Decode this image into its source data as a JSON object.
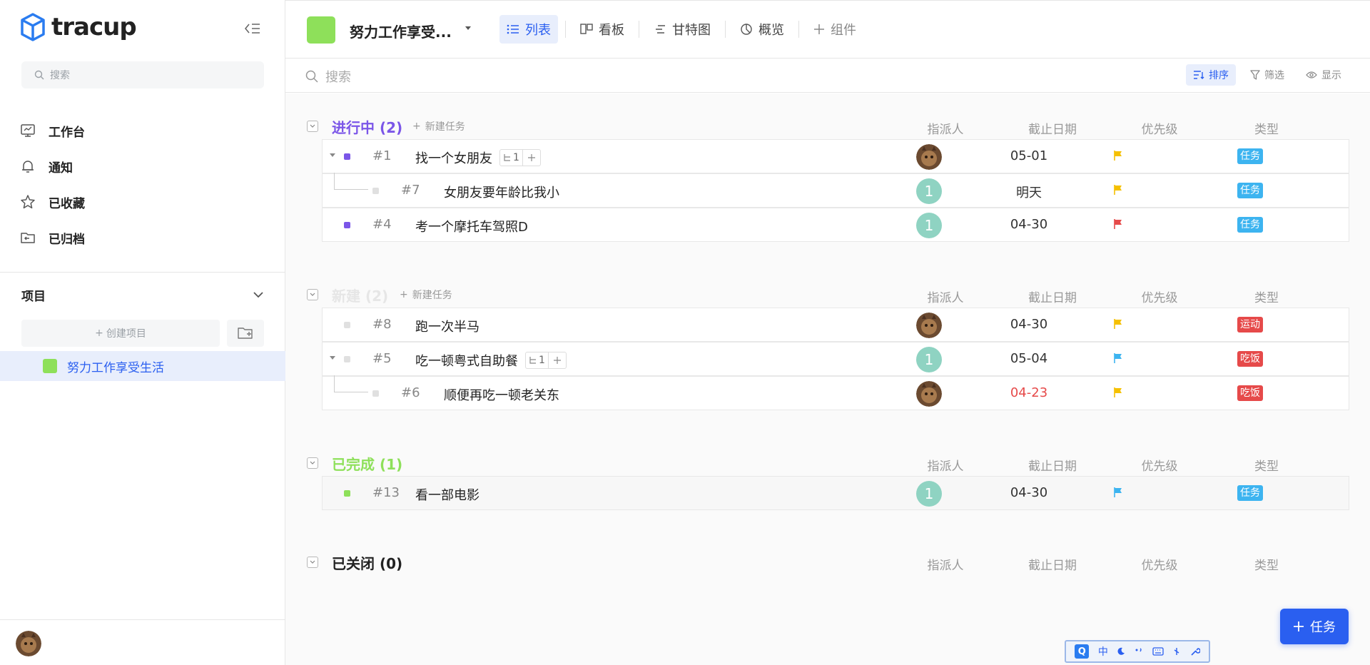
{
  "sidebar": {
    "logo_text": "tracup",
    "search_placeholder": "搜索",
    "nav": [
      {
        "label": "工作台",
        "icon": "monitor-icon"
      },
      {
        "label": "通知",
        "icon": "bell-icon"
      },
      {
        "label": "已收藏",
        "icon": "star-icon"
      },
      {
        "label": "已归档",
        "icon": "archive-icon"
      }
    ],
    "projects_title": "项目",
    "create_project_label": "创建项目",
    "project_item": "努力工作享受生活"
  },
  "topbar": {
    "project_name": "努力工作享受...",
    "tabs": [
      {
        "label": "列表"
      },
      {
        "label": "看板"
      },
      {
        "label": "甘特图"
      },
      {
        "label": "概览"
      },
      {
        "label": "组件"
      }
    ]
  },
  "filterbar": {
    "search_placeholder": "搜索",
    "sort": "排序",
    "filter": "筛选",
    "display": "显示"
  },
  "columns": {
    "assignee": "指派人",
    "due": "截止日期",
    "priority": "优先级",
    "type": "类型"
  },
  "new_task_label": "新建任务",
  "groups": [
    {
      "title": "进行中 (2)",
      "color": "#7b56e8",
      "rows": [
        {
          "num": "#1",
          "title": "找一个女朋友",
          "subcount": "1",
          "assignee": "photo",
          "due": "05-01",
          "priority_color": "#f5c000",
          "type": "任务",
          "type_color": "#3db4f0",
          "dot_color": "#7b56e8"
        },
        {
          "num": "#7",
          "title": "女朋友要年龄比我小",
          "assignee": "1",
          "due": "明天",
          "priority_color": "#f5c000",
          "type": "任务",
          "type_color": "#3db4f0",
          "dot_color": "#dddddd"
        },
        {
          "num": "#4",
          "title": "考一个摩托车驾照D",
          "assignee": "1",
          "due": "04-30",
          "priority_color": "#e64a4a",
          "type": "任务",
          "type_color": "#3db4f0",
          "dot_color": "#7b56e8"
        }
      ]
    },
    {
      "title": "新建 (2)",
      "color": "#e6e6e6",
      "rows": [
        {
          "num": "#8",
          "title": "跑一次半马",
          "assignee": "photo",
          "due": "04-30",
          "priority_color": "#f5c000",
          "type": "运动",
          "type_color": "#e64a4a",
          "dot_color": "#dddddd"
        },
        {
          "num": "#5",
          "title": "吃一顿粤式自助餐",
          "subcount": "1",
          "assignee": "1",
          "due": "05-04",
          "priority_color": "#3db4f0",
          "type": "吃饭",
          "type_color": "#e64a4a",
          "dot_color": "#dddddd"
        },
        {
          "num": "#6",
          "title": "顺便再吃一顿老关东",
          "assignee": "photo",
          "due": "04-23",
          "priority_color": "#f5c000",
          "type": "吃饭",
          "type_color": "#e64a4a",
          "dot_color": "#dddddd"
        }
      ]
    },
    {
      "title": "已完成 (1)",
      "color": "#8ee05a",
      "rows": [
        {
          "num": "#13",
          "title": "看一部电影",
          "assignee": "1",
          "due": "04-30",
          "priority_color": "#3db4f0",
          "type": "任务",
          "type_color": "#3db4f0",
          "dot_color": "#8ee05a"
        }
      ]
    },
    {
      "title": "已关闭 (0)",
      "color": "#222222",
      "rows": []
    }
  ],
  "fab_label": "任务",
  "ime": {
    "lang": "中"
  }
}
